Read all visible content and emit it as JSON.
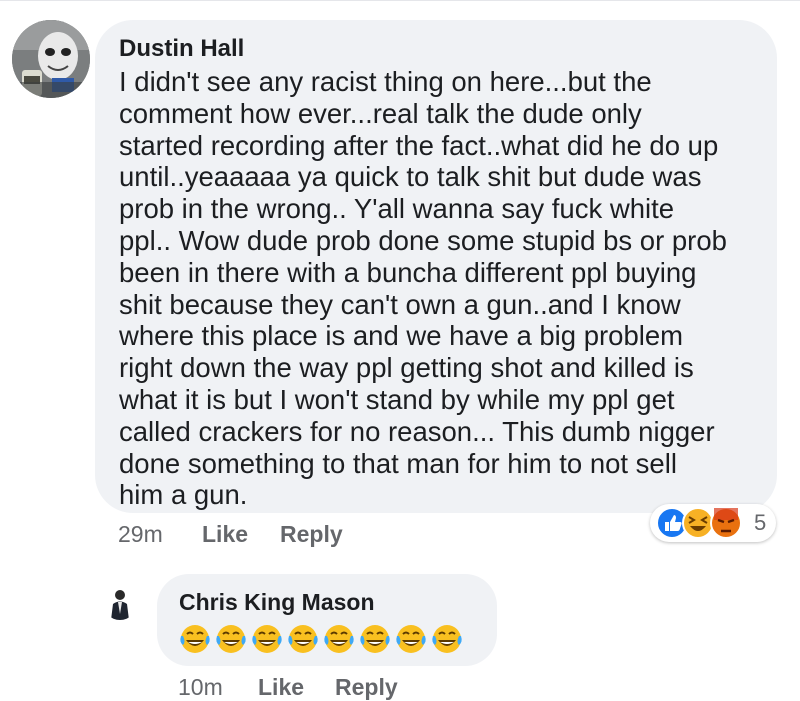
{
  "comments": [
    {
      "author": "Dustin Hall",
      "text": "I didn't see any racist thing on here...but the\ncomment how ever...real talk the dude only\nstarted recording after the fact..what did he do up\nuntil..yeaaaaa ya quick to talk shit but dude was\nprob in the wrong.. Y'all wanna say fuck white\nppl.. Wow dude prob done some stupid bs or prob\nbeen in there with a buncha different ppl buying\nshit because they can't own a gun..and I know\nwhere this place is and we have a big problem\nright down the way ppl getting shot and killed is\nwhat it is but I won't stand by while my ppl get\ncalled crackers for no reason... This dumb nigger\ndone something to that man for him to not sell\nhim a gun.",
      "time": "29m",
      "like_label": "Like",
      "reply_label": "Reply",
      "reactions": {
        "icons": [
          "like-icon",
          "haha-icon",
          "angry-icon"
        ],
        "count": "5",
        "colors": {
          "like": "#1877f2",
          "haha": "#f7b125",
          "angry": "#e9710f"
        }
      }
    },
    {
      "author": "Chris King Mason",
      "emoji": [
        "laughing-tears-icon",
        "laughing-tears-icon",
        "laughing-tears-icon",
        "laughing-tears-icon",
        "laughing-tears-icon",
        "laughing-tears-icon",
        "laughing-tears-icon",
        "laughing-tears-icon"
      ],
      "time": "10m",
      "like_label": "Like",
      "reply_label": "Reply"
    }
  ]
}
